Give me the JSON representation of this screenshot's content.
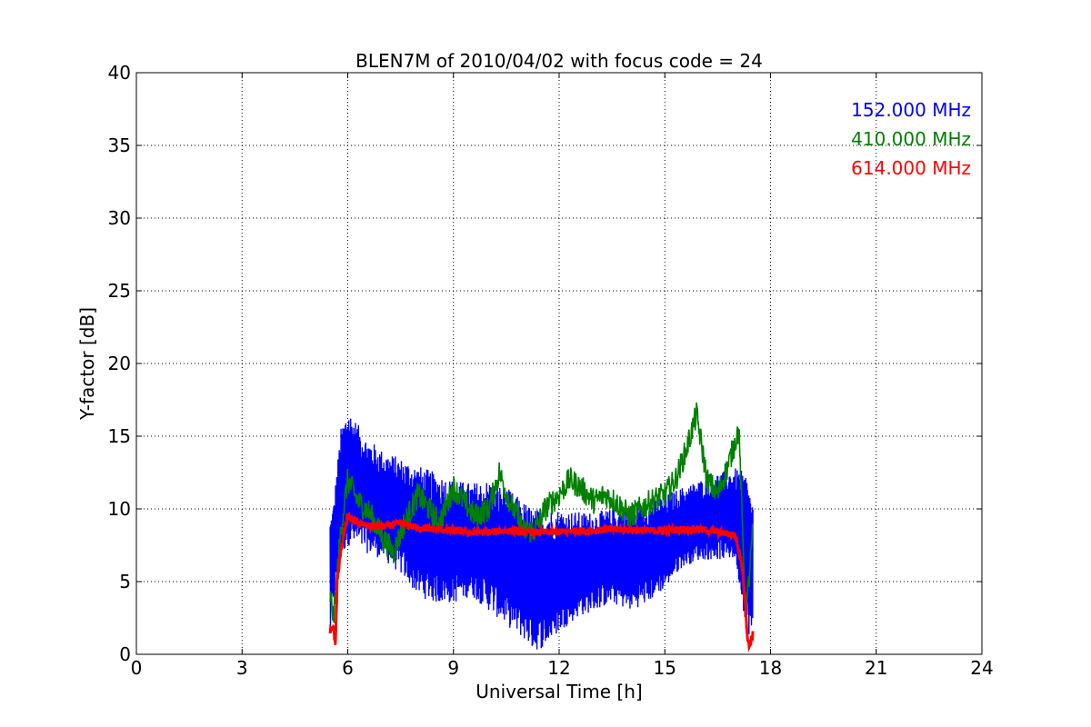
{
  "chart_data": {
    "type": "line",
    "title": "BLEN7M of 2010/04/02 with focus code = 24",
    "xlabel": "Universal Time [h]",
    "ylabel": "Y-factor [dB]",
    "xlim": [
      0,
      24
    ],
    "ylim": [
      0,
      40
    ],
    "xticks": [
      "0",
      "3",
      "6",
      "9",
      "12",
      "15",
      "18",
      "21",
      "24"
    ],
    "yticks": [
      "0",
      "5",
      "10",
      "15",
      "20",
      "25",
      "30",
      "35",
      "40"
    ],
    "grid": true,
    "legend_position": "top-right",
    "series": [
      {
        "name": "152.000 MHz",
        "color": "#0000ff",
        "x": [
          5.5,
          5.6,
          5.8,
          6.0,
          6.5,
          7.0,
          7.5,
          8.0,
          8.5,
          9.0,
          9.5,
          10.0,
          10.5,
          11.0,
          11.3,
          11.6,
          12.0,
          12.5,
          13.0,
          13.5,
          14.0,
          14.5,
          15.0,
          15.5,
          16.0,
          16.5,
          17.0,
          17.3,
          17.5
        ],
        "y_upper": [
          9.5,
          10.5,
          15.5,
          17.0,
          15.0,
          14.0,
          13.5,
          13.0,
          12.5,
          12.0,
          11.8,
          12.0,
          11.5,
          10.5,
          10.0,
          10.0,
          10.0,
          9.8,
          9.8,
          10.0,
          10.2,
          10.5,
          11.0,
          11.5,
          12.0,
          12.5,
          12.8,
          12.5,
          10.5
        ],
        "y_lower": [
          1.0,
          3.5,
          6.5,
          7.5,
          7.0,
          6.5,
          5.5,
          4.0,
          3.5,
          3.5,
          4.0,
          3.0,
          2.0,
          1.0,
          0.2,
          0.5,
          1.5,
          2.5,
          3.0,
          3.5,
          3.0,
          3.5,
          4.5,
          6.0,
          6.5,
          6.5,
          6.5,
          2.0,
          0.5
        ]
      },
      {
        "name": "410.000 MHz",
        "color": "#008000",
        "x": [
          5.5,
          5.6,
          5.8,
          6.0,
          6.3,
          6.6,
          7.0,
          7.3,
          7.6,
          8.0,
          8.3,
          8.6,
          9.0,
          9.3,
          9.6,
          10.0,
          10.3,
          10.6,
          11.0,
          11.3,
          11.6,
          12.0,
          12.3,
          12.6,
          13.0,
          13.3,
          13.6,
          14.0,
          14.3,
          14.6,
          15.0,
          15.3,
          15.6,
          15.9,
          16.2,
          16.5,
          16.8,
          17.1,
          17.3,
          17.5
        ],
        "y": [
          4.0,
          2.5,
          8.5,
          12.0,
          10.5,
          9.8,
          8.0,
          7.0,
          9.0,
          11.0,
          10.0,
          9.0,
          11.5,
          10.5,
          9.5,
          10.0,
          12.5,
          10.5,
          8.5,
          8.5,
          10.0,
          11.0,
          12.0,
          11.5,
          10.5,
          11.0,
          10.5,
          9.5,
          10.0,
          10.5,
          11.0,
          12.0,
          14.0,
          16.5,
          12.0,
          11.0,
          13.0,
          15.5,
          2.5,
          8.5
        ]
      },
      {
        "name": "614.000 MHz",
        "color": "#ff0000",
        "x": [
          5.5,
          5.6,
          5.65,
          5.7,
          5.8,
          5.9,
          6.0,
          6.3,
          6.6,
          7.0,
          7.5,
          8.0,
          8.5,
          9.0,
          9.5,
          10.0,
          10.5,
          11.0,
          11.5,
          12.0,
          12.5,
          13.0,
          13.5,
          14.0,
          14.5,
          15.0,
          15.5,
          16.0,
          16.5,
          17.0,
          17.2,
          17.3,
          17.35,
          17.4,
          17.5
        ],
        "y": [
          1.5,
          2.0,
          0.5,
          5.0,
          7.0,
          8.5,
          9.5,
          9.0,
          8.8,
          8.8,
          9.0,
          8.7,
          8.6,
          8.5,
          8.4,
          8.4,
          8.5,
          8.4,
          8.4,
          8.4,
          8.5,
          8.5,
          8.6,
          8.6,
          8.5,
          8.5,
          8.6,
          8.6,
          8.4,
          8.2,
          6.0,
          3.0,
          1.0,
          0.5,
          1.5
        ]
      }
    ]
  }
}
